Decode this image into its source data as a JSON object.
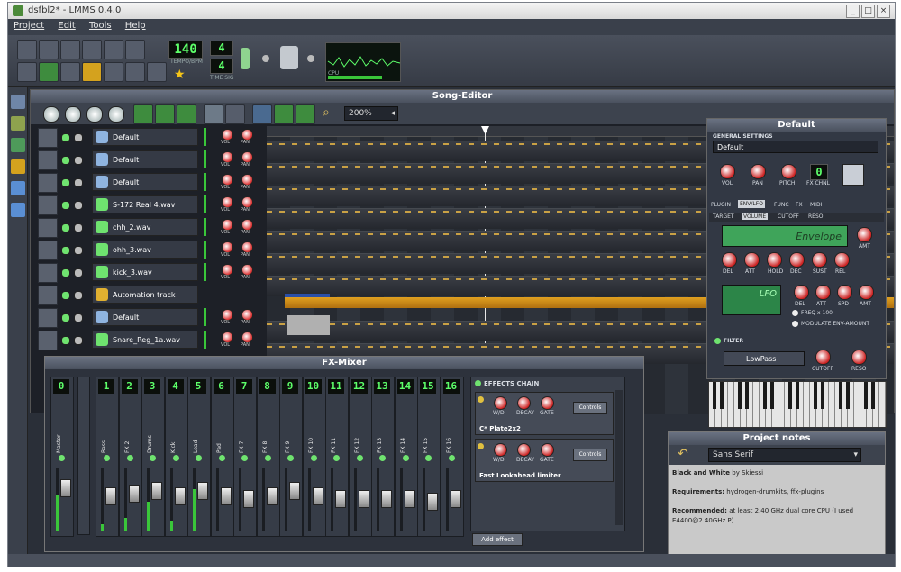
{
  "window": {
    "title": "dsfbl2* - LMMS 0.4.0",
    "minimize": "_",
    "maximize": "□",
    "close": "×"
  },
  "menu": [
    "Project",
    "Edit",
    "Tools",
    "Help"
  ],
  "toolbar": {
    "tempo": "140",
    "tempo_label": "TEMPO/BPM",
    "timesig_num": "4",
    "timesig_den": "4",
    "timesig_label": "TIME SIG",
    "cpu_label": "CPU"
  },
  "song_editor": {
    "title": "Song-Editor",
    "zoom": "200%",
    "tracks": [
      {
        "name": "Default",
        "icon": "instrument-icon"
      },
      {
        "name": "Default",
        "icon": "instrument-icon"
      },
      {
        "name": "Default",
        "icon": "instrument-icon"
      },
      {
        "name": "S-172 Real 4.wav",
        "icon": "audio-file-icon"
      },
      {
        "name": "chh_2.wav",
        "icon": "audio-file-icon"
      },
      {
        "name": "ohh_3.wav",
        "icon": "audio-file-icon"
      },
      {
        "name": "kick_3.wav",
        "icon": "audio-file-icon"
      },
      {
        "name": "Automation track",
        "icon": "automation-icon"
      },
      {
        "name": "Default",
        "icon": "instrument-icon"
      },
      {
        "name": "Snare_Reg_1a.wav",
        "icon": "audio-file-icon"
      }
    ],
    "knob_labels": {
      "vol": "VOL",
      "pan": "PAN"
    }
  },
  "instrument": {
    "title": "Default",
    "general_settings": "GENERAL SETTINGS",
    "name": "Default",
    "knobs": [
      "VOL",
      "PAN",
      "PITCH"
    ],
    "fx_channel": "0",
    "fx_label": "FX CHNL",
    "tabs": [
      "PLUGIN",
      "ENV/LFO",
      "FUNC",
      "FX",
      "MIDI"
    ],
    "subtabs": [
      "TARGET",
      "VOLUME",
      "CUTOFF",
      "RESO"
    ],
    "envelope": "Envelope",
    "env_knobs": [
      "DEL",
      "ATT",
      "HOLD",
      "DEC",
      "SUST",
      "REL",
      "AMT"
    ],
    "lfo": "LFO",
    "lfo_knobs": [
      "DEL",
      "ATT",
      "SPD",
      "AMT"
    ],
    "freq_x100": "FREQ x 100",
    "modulate_env": "MODULATE ENV-AMOUNT",
    "filter": "FILTER",
    "filter_type": "LowPass",
    "filter_knobs": [
      "CUTOFF",
      "RESO"
    ]
  },
  "fx_mixer": {
    "title": "FX-Mixer",
    "channels": [
      {
        "num": "0",
        "name": "Master",
        "meter": 0.55,
        "fader": 0.3
      },
      {
        "num": "1",
        "name": "Bass",
        "meter": 0.1,
        "fader": 0.45
      },
      {
        "num": "2",
        "name": "FX 2",
        "meter": 0.2,
        "fader": 0.4
      },
      {
        "num": "3",
        "name": "Drums",
        "meter": 0.45,
        "fader": 0.35
      },
      {
        "num": "4",
        "name": "Kick",
        "meter": 0.15,
        "fader": 0.45
      },
      {
        "num": "5",
        "name": "Lead",
        "meter": 0.65,
        "fader": 0.35
      },
      {
        "num": "6",
        "name": "Pad",
        "meter": 0.0,
        "fader": 0.45
      },
      {
        "num": "7",
        "name": "FX 7",
        "meter": 0.0,
        "fader": 0.5
      },
      {
        "num": "8",
        "name": "FX 8",
        "meter": 0.0,
        "fader": 0.45
      },
      {
        "num": "9",
        "name": "FX 9",
        "meter": 0.0,
        "fader": 0.35
      },
      {
        "num": "10",
        "name": "FX 10",
        "meter": 0.0,
        "fader": 0.45
      },
      {
        "num": "11",
        "name": "FX 11",
        "meter": 0.0,
        "fader": 0.5
      },
      {
        "num": "12",
        "name": "FX 12",
        "meter": 0.0,
        "fader": 0.5
      },
      {
        "num": "13",
        "name": "FX 13",
        "meter": 0.0,
        "fader": 0.5
      },
      {
        "num": "14",
        "name": "FX 14",
        "meter": 0.0,
        "fader": 0.5
      },
      {
        "num": "15",
        "name": "FX 15",
        "meter": 0.0,
        "fader": 0.55
      },
      {
        "num": "16",
        "name": "FX 16",
        "meter": 0.0,
        "fader": 0.5
      }
    ],
    "effects_chain": "EFFECTS CHAIN",
    "effects": [
      {
        "name": "C* Plate2x2",
        "knobs": [
          "W/D",
          "DECAY",
          "GATE"
        ],
        "controls": "Controls"
      },
      {
        "name": "Fast Lookahead limiter",
        "knobs": [
          "W/D",
          "DECAY",
          "GATE"
        ],
        "controls": "Controls"
      }
    ],
    "add_effect": "Add effect"
  },
  "project_notes": {
    "title": "Project notes",
    "font": "Sans Serif",
    "paragraphs": [
      {
        "bold": "Black and White",
        "rest": " by Skiessi"
      },
      {
        "bold": "Requirements:",
        "rest": " hydrogen-drumkits, ffx-plugins"
      },
      {
        "bold": "Recommended:",
        "rest": " at least 2.40 GHz dual core CPU (I used E4400@2.40GHz P)"
      }
    ]
  }
}
